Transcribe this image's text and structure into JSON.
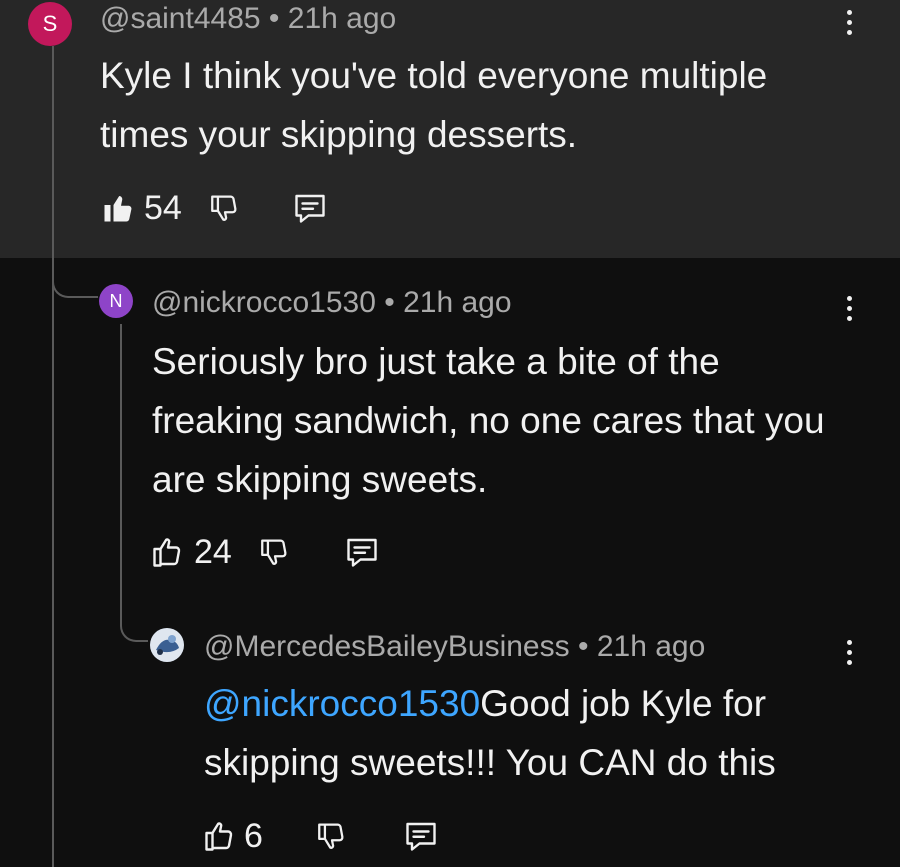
{
  "comments": [
    {
      "avatar_letter": "S",
      "avatar_color": "#c2185b",
      "handle": "@saint4485",
      "separator": "•",
      "time": "21h ago",
      "text": "Kyle I think you've told everyone multiple times your skipping desserts.",
      "likes": "54",
      "liked": true
    },
    {
      "avatar_letter": "N",
      "avatar_color": "#8e44c8",
      "handle": "@nickrocco1530",
      "separator": "•",
      "time": "21h ago",
      "text": "Seriously bro just take a bite of the freaking sandwich, no one cares that you are skipping sweets.",
      "likes": "24",
      "liked": false
    },
    {
      "avatar_icon": "profile-photo-icon",
      "handle": "@MercedesBaileyBusiness",
      "separator": "•",
      "time": "21h ago",
      "mention": "@nickrocco1530",
      "text": "Good job Kyle for skipping sweets!!! You CAN do this",
      "likes": "6",
      "liked": false
    }
  ],
  "colors": {
    "background": "#0f0f0f",
    "highlight_background": "#272727",
    "text": "#f1f1f1",
    "meta_text": "#aaaaaa",
    "mention": "#3ea6ff"
  }
}
